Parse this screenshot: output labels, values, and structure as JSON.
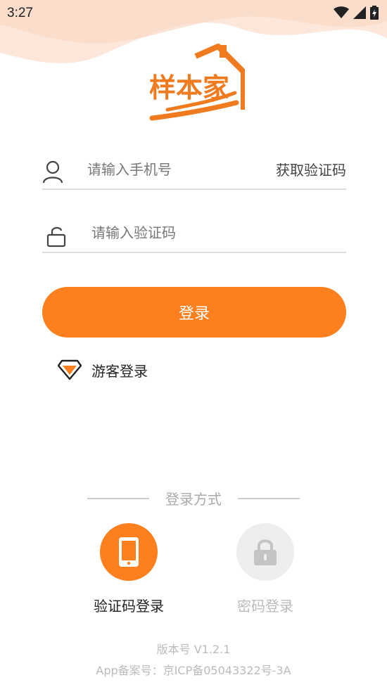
{
  "status_bar": {
    "time": "3:27",
    "icons": [
      "wifi-icon",
      "signal-icon",
      "battery-charging-icon"
    ]
  },
  "logo": {
    "text": "样本家"
  },
  "phone_field": {
    "placeholder": "请输入手机号",
    "value": "",
    "icon": "user-icon"
  },
  "get_code": {
    "label": "获取验证码"
  },
  "code_field": {
    "placeholder": "请输入验证码",
    "value": "",
    "icon": "unlock-icon"
  },
  "login_button": {
    "label": "登录"
  },
  "guest_login": {
    "label": "游客登录",
    "icon": "diamond-icon"
  },
  "methods": {
    "title": "登录方式",
    "sms": {
      "label": "验证码登录",
      "icon": "phone-icon",
      "active": true
    },
    "password": {
      "label": "密码登录",
      "icon": "lock-icon",
      "active": false
    }
  },
  "footer": {
    "version": "版本号 V1.2.1",
    "icp": "App备案号：京ICP备05043322号-3A"
  },
  "colors": {
    "accent": "#fd7f1e",
    "inactive": "#eeeeee",
    "wave": "#fce3d3"
  }
}
